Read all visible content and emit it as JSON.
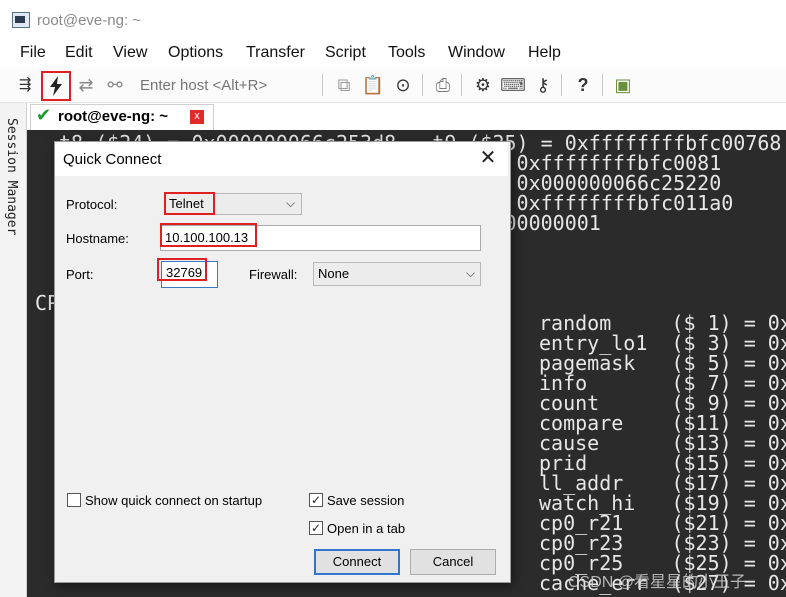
{
  "window": {
    "title": "root@eve-ng: ~"
  },
  "menu": [
    "File",
    "Edit",
    "View",
    "Options",
    "Transfer",
    "Script",
    "Tools",
    "Window",
    "Help"
  ],
  "toolbar": {
    "icons": [
      "connect-icon",
      "quick-connect-icon",
      "reconnect-icon",
      "disconnect-icon",
      "copy-icon",
      "paste-icon",
      "find-icon",
      "print-icon",
      "settings-icon",
      "keymap-icon",
      "key-icon",
      "help-icon",
      "sftp-icon"
    ],
    "host_placeholder": "Enter host <Alt+R>",
    "highlight_color": "#e02020"
  },
  "side_panel": {
    "label": "Session Manager"
  },
  "tab": {
    "label": "root@eve-ng: ~",
    "status_icon": "check-icon",
    "close_label": "x"
  },
  "terminal": {
    "top_lines": [
      "t8 ($24) = 0x000000066c253d8   t9 ($25) = 0xffffffffbfc00768",
      "                               t27) = 0xffffffffbfc0081",
      "                               t29) = 0x000000066c25220",
      "                               t31) = 0xffffffffbfc011a0",
      "                                  00000000001"
    ],
    "left_fragment": "CP",
    "registers": [
      "random     ($ 1) = 0x",
      "entry_lo1  ($ 3) = 0x",
      "pagemask   ($ 5) = 0x",
      "info       ($ 7) = 0x",
      "count      ($ 9) = 0x",
      "compare    ($11) = 0x",
      "cause      ($13) = 0x",
      "prid       ($15) = 0x",
      "ll_addr    ($17) = 0x",
      "watch_hi   ($19) = 0x",
      "cp0_r21    ($21) = 0x",
      "cp0_r23    ($23) = 0x",
      "cp0_r25    ($25) = 0x",
      "cache_err  ($27) = 0x"
    ],
    "watermark": "CSDN @看星星的小王子"
  },
  "dialog": {
    "title": "Quick Connect",
    "protocol_label": "Protocol:",
    "protocol_value": "Telnet",
    "hostname_label": "Hostname:",
    "hostname_value": "10.100.100.13",
    "port_label": "Port:",
    "port_value": "32769",
    "firewall_label": "Firewall:",
    "firewall_value": "None",
    "show_on_startup_label": "Show quick connect on startup",
    "show_on_startup_checked": false,
    "save_session_label": "Save session",
    "save_session_checked": true,
    "open_in_tab_label": "Open in a tab",
    "open_in_tab_checked": true,
    "connect_label": "Connect",
    "cancel_label": "Cancel",
    "close_glyph": "✕"
  }
}
